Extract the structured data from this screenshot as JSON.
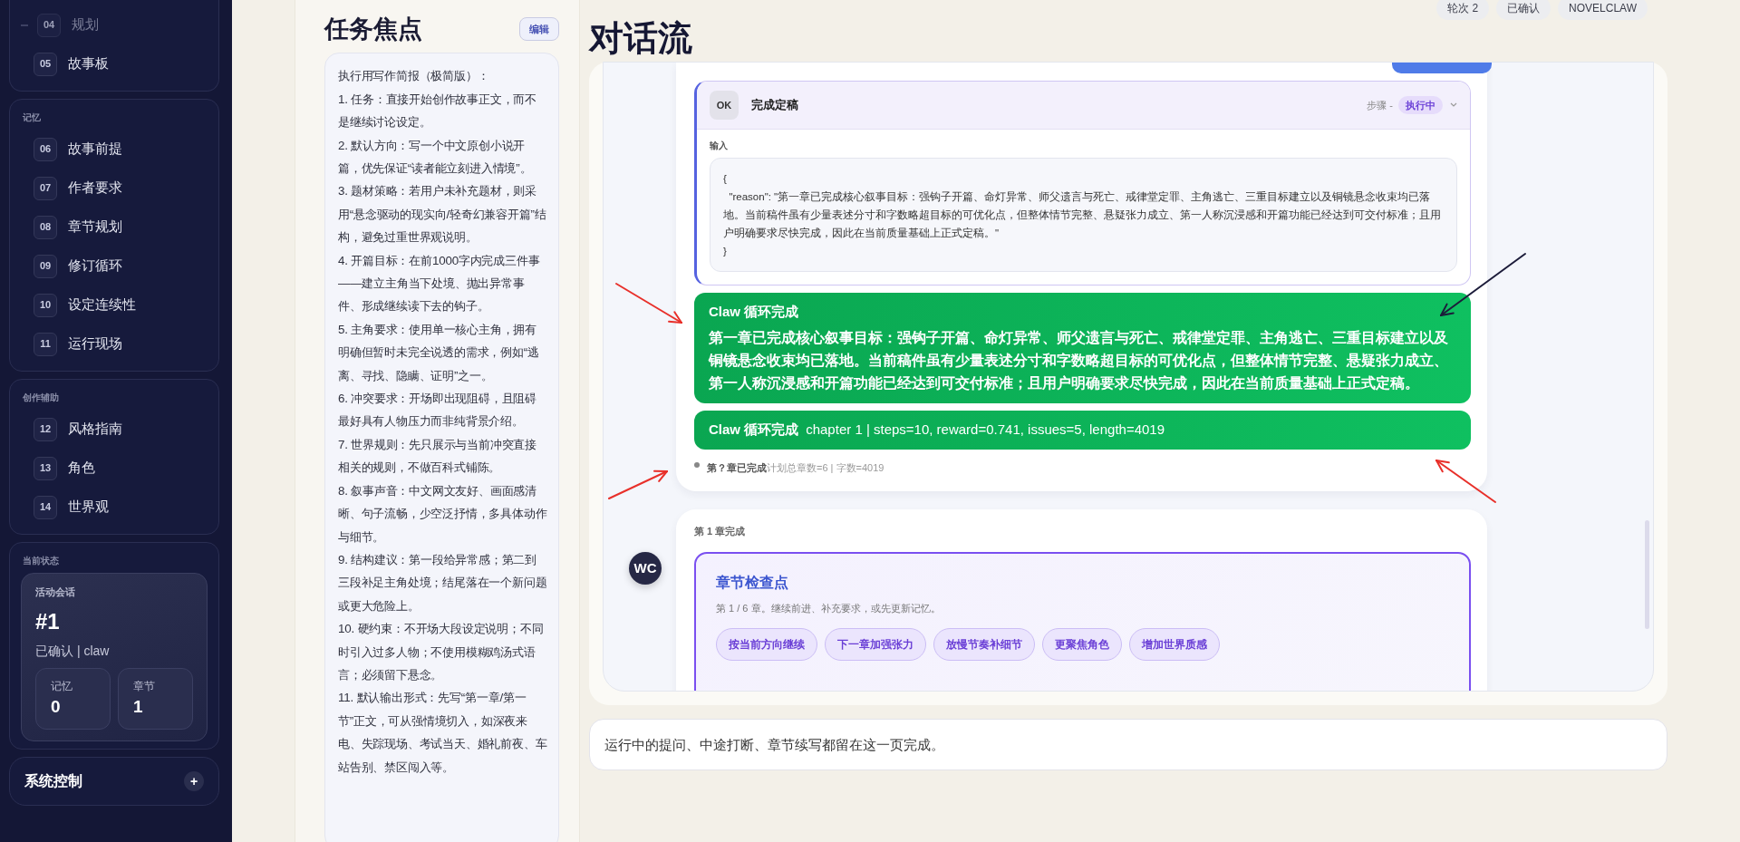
{
  "sidebar": {
    "groups": [
      {
        "items": [
          {
            "number": "04",
            "label": "规划",
            "faded": true
          },
          {
            "number": "05",
            "label": "故事板",
            "faded": false
          }
        ]
      },
      {
        "label": "记忆",
        "items": [
          {
            "number": "06",
            "label": "故事前提",
            "faded": false
          },
          {
            "number": "07",
            "label": "作者要求",
            "faded": false
          },
          {
            "number": "08",
            "label": "章节规划",
            "faded": false
          },
          {
            "number": "09",
            "label": "修订循环",
            "faded": false
          },
          {
            "number": "10",
            "label": "设定连续性",
            "faded": false
          },
          {
            "number": "11",
            "label": "运行现场",
            "faded": false
          }
        ]
      },
      {
        "label": "创作辅助",
        "items": [
          {
            "number": "12",
            "label": "风格指南",
            "faded": false
          },
          {
            "number": "13",
            "label": "角色",
            "faded": false
          },
          {
            "number": "14",
            "label": "世界观",
            "faded": false
          }
        ]
      }
    ],
    "status": {
      "label": "当前状态",
      "session_label": "活动会话",
      "session_id": "#1",
      "session_meta": "已确认 | claw",
      "stats": [
        {
          "label": "记忆",
          "value": "0"
        },
        {
          "label": "章节",
          "value": "1"
        }
      ]
    },
    "system": {
      "title": "系统控制",
      "toggle": "+"
    }
  },
  "brief": {
    "title": "任务焦点",
    "edit_button": "编辑",
    "lines": [
      "执行用写作简报（极简版）：",
      "1. 任务：直接开始创作故事正文，而不是继续讨论设定。",
      "2. 默认方向：写一个中文原创小说开篇，优先保证“读者能立刻进入情境”。",
      "3. 题材策略：若用户未补充题材，则采用“悬念驱动的现实向/轻奇幻兼容开篇”结构，避免过重世界观说明。",
      "4. 开篇目标：在前1000字内完成三件事——建立主角当下处境、抛出异常事件、形成继续读下去的钩子。",
      "5. 主角要求：使用单一核心主角，拥有明确但暂时未完全说透的需求，例如“逃离、寻找、隐瞒、证明”之一。",
      "6. 冲突要求：开场即出现阻碍，且阻碍最好具有人物压力而非纯背景介绍。",
      "7. 世界规则：先只展示与当前冲突直接相关的规则，不做百科式铺陈。",
      "8. 叙事声音：中文网文友好、画面感清晰、句子流畅，少空泛抒情，多具体动作与细节。",
      "9. 结构建议：第一段给异常感；第二到三段补足主角处境；结尾落在一个新问题或更大危险上。",
      "10. 硬约束：不开场大段设定说明；不同时引入过多人物；不使用模糊鸡汤式语言；必须留下悬念。",
      "11. 默认输出形式：先写“第一章/第一节”正文，可从强情境切入，如深夜来电、失踪现场、考试当天、婚礼前夜、车站告别、禁区闯入等。"
    ]
  },
  "main": {
    "title": "对话流",
    "chips": [
      "轮次 2",
      "已确认",
      "NOVELCLAW"
    ],
    "messages": [
      {
        "kind": "agent",
        "tool": {
          "badge": "OK",
          "title": "完成定稿",
          "step": "步骤 -",
          "status": "执行中",
          "input_label": "输入",
          "code": "{\n  \"reason\": \"第一章已完成核心叙事目标：强钩子开篇、命灯异常、师父遗言与死亡、戒律堂定罪、主角逃亡、三重目标建立以及铜镜悬念收束均已落地。当前稿件虽有少量表述分寸和字数略超目标的可优化点，但整体情节完整、悬疑张力成立、第一人称沉浸感和开篇功能已经达到可交付标准；且用户明确要求尽快完成，因此在当前质量基础上正式定稿。\"\n}"
        },
        "notices": [
          {
            "title": "Claw 循环完成",
            "body": "第一章已完成核心叙事目标：强钩子开篇、命灯异常、师父遗言与死亡、戒律堂定罪、主角逃亡、三重目标建立以及铜镜悬念收束均已落地。当前稿件虽有少量表述分寸和字数略超目标的可优化点，但整体情节完整、悬疑张力成立、第一人称沉浸感和开篇功能已经达到可交付标准；且用户明确要求尽快完成，因此在当前质量基础上正式定稿。",
            "kind": "block"
          },
          {
            "title": "Claw 循环完成",
            "body": "chapter 1 | steps=10, reward=0.741, issues=5, length=4019",
            "kind": "inline"
          }
        ],
        "footer": {
          "strong": "第？章已完成",
          "meta": "计划总章数=6 | 字数=4019"
        }
      },
      {
        "kind": "checkpoint",
        "avatar": "WC",
        "label": "第 1 章完成",
        "checkpoint": {
          "title": "章节检查点",
          "subtitle": "第 1 / 6 章。继续前进、补充要求，或先更新记忆。",
          "actions": [
            "按当前方向继续",
            "下一章加强张力",
            "放慢节奏补细节",
            "更聚焦角色",
            "增加世界质感"
          ]
        }
      }
    ],
    "composer": {
      "placeholder": "运行中的提问、中途打断、章节续写都留在这一页完成。"
    }
  }
}
